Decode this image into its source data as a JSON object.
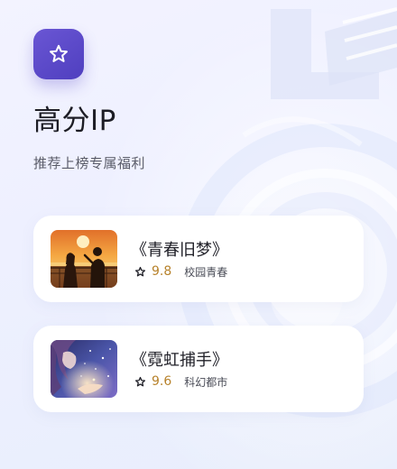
{
  "header": {
    "badge_icon": "star-outline-icon",
    "title": "高分IP",
    "subtitle": "推荐上榜专属福利"
  },
  "books": [
    {
      "title": "《青春旧梦》",
      "rating": "9.8",
      "genre": "校园青春",
      "cover": "sunset-couple-cover"
    },
    {
      "title": "《霓虹捕手》",
      "rating": "9.6",
      "genre": "科幻都市",
      "cover": "starry-girl-cover"
    }
  ],
  "colors": {
    "accent": "#5a48c8",
    "rating": "#b7822b",
    "title": "#1d1d25",
    "subtitle": "#5a5c68"
  }
}
